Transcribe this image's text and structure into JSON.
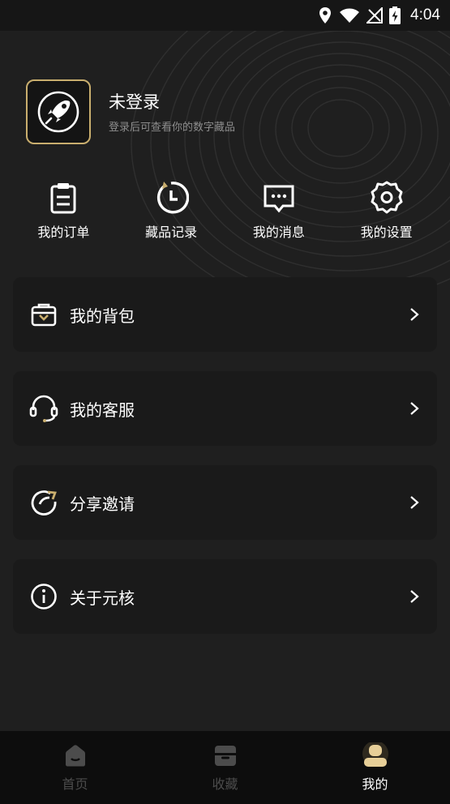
{
  "status_bar": {
    "time": "4:04"
  },
  "profile": {
    "name": "未登录",
    "subtitle": "登录后可查看你的数字藏品"
  },
  "quick_actions": [
    {
      "label": "我的订单",
      "icon": "clipboard-icon"
    },
    {
      "label": "藏品记录",
      "icon": "history-clock-icon"
    },
    {
      "label": "我的消息",
      "icon": "message-icon"
    },
    {
      "label": "我的设置",
      "icon": "gear-icon"
    }
  ],
  "menu": [
    {
      "label": "我的背包",
      "icon": "backpack-icon"
    },
    {
      "label": "我的客服",
      "icon": "headset-icon"
    },
    {
      "label": "分享邀请",
      "icon": "share-icon"
    },
    {
      "label": "关于元核",
      "icon": "info-icon"
    }
  ],
  "bottom_nav": [
    {
      "label": "首页",
      "icon": "home-icon",
      "active": false
    },
    {
      "label": "收藏",
      "icon": "collection-box-icon",
      "active": false
    },
    {
      "label": "我的",
      "icon": "user-icon",
      "active": true
    }
  ],
  "colors": {
    "background": "#1f1f1f",
    "card": "#1a1a1a",
    "accent_gold": "#c9ae6e",
    "inactive_nav": "#4c4c4c"
  }
}
